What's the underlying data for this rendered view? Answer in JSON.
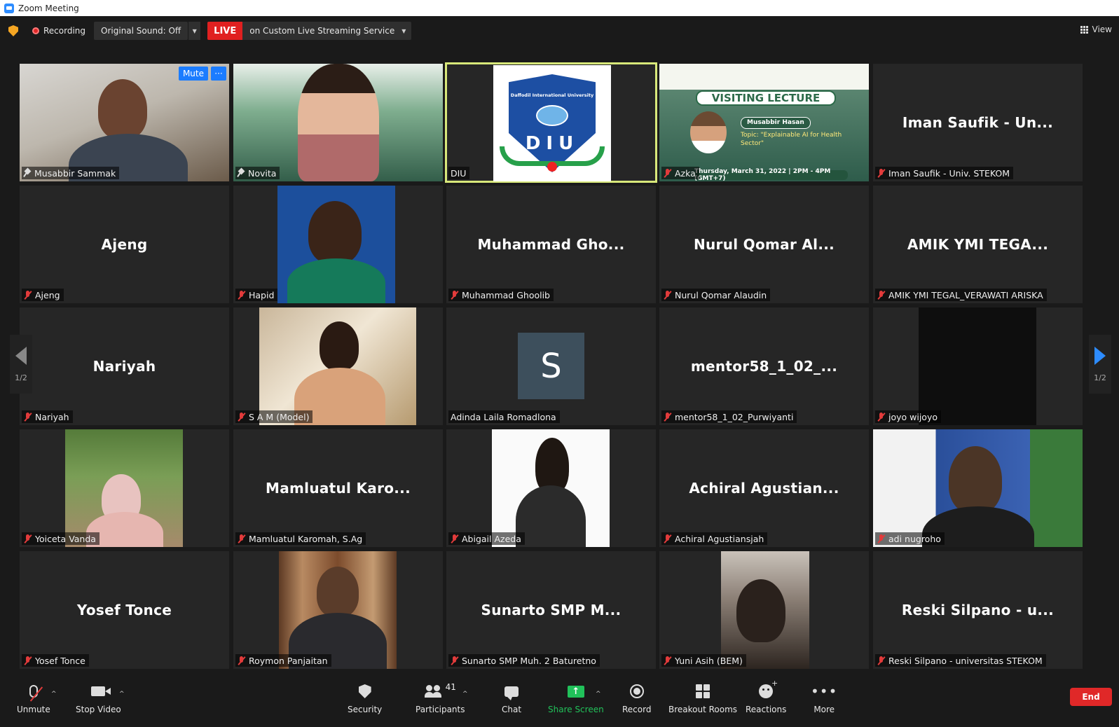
{
  "window": {
    "title": "Zoom Meeting"
  },
  "topbar": {
    "recording_label": "Recording",
    "original_sound": "Original Sound: Off",
    "live_badge": "LIVE",
    "live_service": "on Custom Live Streaming Service",
    "view_label": "View"
  },
  "tiles": [
    {
      "label": "Musabbir Sammak",
      "display_name": "",
      "mic": "on"
    },
    {
      "label": "Novita",
      "display_name": "",
      "mic": "on"
    },
    {
      "label": "DIU",
      "display_name": "",
      "mic": "none"
    },
    {
      "label": "Azka",
      "display_name": "",
      "mic": "off"
    },
    {
      "label": "Iman Saufik - Univ. STEKOM",
      "display_name": "Iman Saufik - Un...",
      "mic": "off"
    },
    {
      "label": "Ajeng",
      "display_name": "Ajeng",
      "mic": "off"
    },
    {
      "label": "Hapid",
      "display_name": "",
      "mic": "off"
    },
    {
      "label": "Muhammad Ghoolib",
      "display_name": "Muhammad Gho...",
      "mic": "off"
    },
    {
      "label": "Nurul Qomar Alaudin",
      "display_name": "Nurul Qomar Al...",
      "mic": "off"
    },
    {
      "label": "AMIK YMI TEGAL_VERAWATI ARISKA",
      "display_name": "AMIK YMI TEGA...",
      "mic": "off"
    },
    {
      "label": "Nariyah",
      "display_name": "Nariyah",
      "mic": "off"
    },
    {
      "label": "S A M (Model)",
      "display_name": "",
      "mic": "off"
    },
    {
      "label": "Adinda Laila Romadlona",
      "display_name": "",
      "mic": "none"
    },
    {
      "label": "mentor58_1_02_Purwiyanti",
      "display_name": "mentor58_1_02_...",
      "mic": "off"
    },
    {
      "label": "joyo wijoyo",
      "display_name": "",
      "mic": "off"
    },
    {
      "label": "Yoiceta Vanda",
      "display_name": "",
      "mic": "off"
    },
    {
      "label": "Mamluatul Karomah, S.Ag",
      "display_name": "Mamluatul Karo...",
      "mic": "off"
    },
    {
      "label": "Abigail Azeda",
      "display_name": "",
      "mic": "off"
    },
    {
      "label": "Achiral Agustiansjah",
      "display_name": "Achiral Agustian...",
      "mic": "off"
    },
    {
      "label": "adi nugroho",
      "display_name": "",
      "mic": "off"
    },
    {
      "label": "Yosef Tonce",
      "display_name": "Yosef Tonce",
      "mic": "off"
    },
    {
      "label": "Roymon Panjaitan",
      "display_name": "",
      "mic": "off"
    },
    {
      "label": "Sunarto SMP Muh. 2 Baturetno",
      "display_name": "Sunarto SMP M...",
      "mic": "off"
    },
    {
      "label": "Yuni Asih (BEM)",
      "display_name": "",
      "mic": "off"
    },
    {
      "label": "Reski Silpano - universitas STEKOM",
      "display_name": "Reski Silpano - u...",
      "mic": "off"
    }
  ],
  "tile_controls": {
    "mute_label": "Mute",
    "more_label": "···"
  },
  "diu_logo": {
    "university": "Daffodil International University",
    "letters": "DIU"
  },
  "lecture_poster": {
    "title": "VISITING LECTURE",
    "speaker": "Musabbir Hasan",
    "topic": "Topic: \"Explainable AI for Health Sector\"",
    "date": "Thursday, March 31, 2022 | 2PM - 4PM (GMT+7)"
  },
  "avatar_initial": "S",
  "pagination": {
    "left": "1/2",
    "right": "1/2"
  },
  "toolbar": {
    "unmute": "Unmute",
    "stop_video": "Stop Video",
    "security": "Security",
    "participants": "Participants",
    "participants_count": "41",
    "chat": "Chat",
    "share_screen": "Share Screen",
    "record": "Record",
    "breakout_rooms": "Breakout Rooms",
    "reactions": "Reactions",
    "more": "More",
    "end": "End"
  },
  "colors": {
    "share_screen_green": "#21c15a",
    "live_red": "#e02020",
    "active_speaker_border": "#d8e87a",
    "accent_blue": "#2d8cff"
  }
}
